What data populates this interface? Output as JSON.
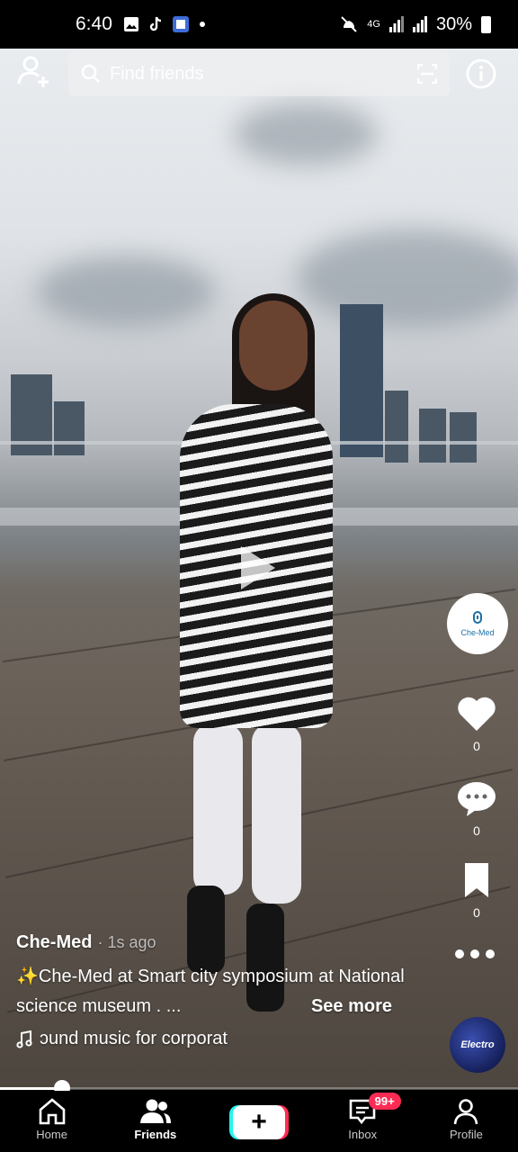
{
  "status_bar": {
    "time": "6:40",
    "network": "4G",
    "battery": "30%",
    "left_icons": [
      "image-icon",
      "tiktok-icon",
      "app-icon",
      "dot-icon"
    ],
    "right_icons": [
      "mute-icon",
      "signal-icon",
      "signal-icon",
      "battery-icon"
    ]
  },
  "top_bar": {
    "search_placeholder": "Find friends"
  },
  "right_actions": {
    "profile_avatar_label": "Che-Med",
    "like_count": "0",
    "comment_count": "0",
    "bookmark_count": "0"
  },
  "caption": {
    "author": "Che-Med",
    "posted": "· 1s ago",
    "description": "✨Che-Med at Smart city symposium at National science museum . ...",
    "see_more": "See more",
    "sound": "ɔund music for corporat"
  },
  "music_disc": {
    "label": "Electro"
  },
  "playback": {
    "progress_fraction": 0.12
  },
  "bottom_nav": {
    "items": [
      {
        "label": "Home",
        "icon": "home-icon"
      },
      {
        "label": "Friends",
        "icon": "friends-icon"
      },
      {
        "label": "",
        "icon": "create-icon"
      },
      {
        "label": "Inbox",
        "icon": "inbox-icon",
        "badge": "99+"
      },
      {
        "label": "Profile",
        "icon": "profile-icon"
      }
    ],
    "active_index": 1
  },
  "colors": {
    "accent_red": "#fe2c55",
    "accent_cyan": "#25f4ee",
    "brand_blue": "#1d6fa5"
  }
}
